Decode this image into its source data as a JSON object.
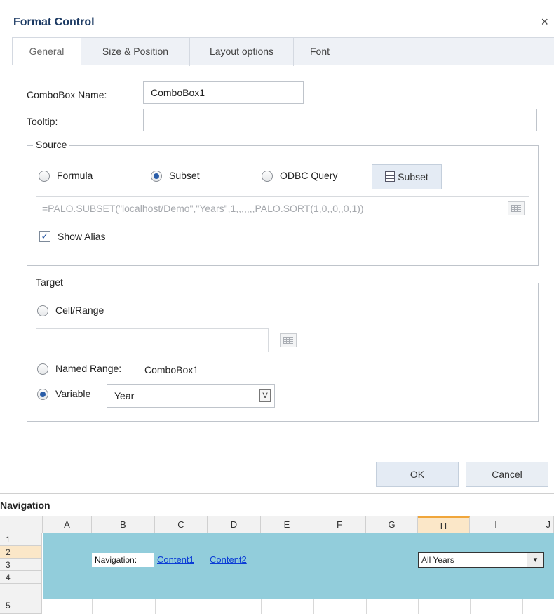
{
  "dialog": {
    "title": "Format Control",
    "close_glyph": "×",
    "tabs": [
      {
        "label": "General",
        "active": true
      },
      {
        "label": "Size & Position",
        "active": false
      },
      {
        "label": "Layout options",
        "active": false
      },
      {
        "label": "Font",
        "active": false
      }
    ],
    "combobox_name_label": "ComboBox Name:",
    "combobox_name_value": "ComboBox1",
    "tooltip_label": "Tooltip:",
    "tooltip_value": "",
    "source": {
      "legend": "Source",
      "options": [
        {
          "label": "Formula",
          "selected": false
        },
        {
          "label": "Subset",
          "selected": true
        },
        {
          "label": "ODBC Query",
          "selected": false
        }
      ],
      "subset_button_label": "Subset",
      "formula_value": "=PALO.SUBSET(\"localhost/Demo\",\"Years\",1,,,,,,,PALO.SORT(1,0,,0,,0,1))",
      "show_alias_label": "Show Alias",
      "show_alias_checked": true,
      "check_glyph": "✓"
    },
    "target": {
      "legend": "Target",
      "cell_range_label": "Cell/Range",
      "cell_range_value": "",
      "named_range_label": "Named Range:",
      "named_range_value": "ComboBox1",
      "variable_label": "Variable",
      "variable_value": "Year",
      "variable_button_glyph": "V",
      "selected": "Variable"
    },
    "ok_label": "OK",
    "cancel_label": "Cancel"
  },
  "spreadsheet": {
    "section_title": "Navigation",
    "columns": [
      "A",
      "B",
      "C",
      "D",
      "E",
      "F",
      "G",
      "H",
      "I",
      "J"
    ],
    "selected_column": "H",
    "rows": [
      "1",
      "2",
      "3",
      "4",
      "5"
    ],
    "selected_row": "2",
    "nav_label": "Navigation:",
    "links": [
      "Content1",
      "Content2"
    ],
    "combo_value": "All Years",
    "combo_arrow_glyph": "▾",
    "teal_color": "#92cddb",
    "link_color": "#0b3cd6"
  }
}
